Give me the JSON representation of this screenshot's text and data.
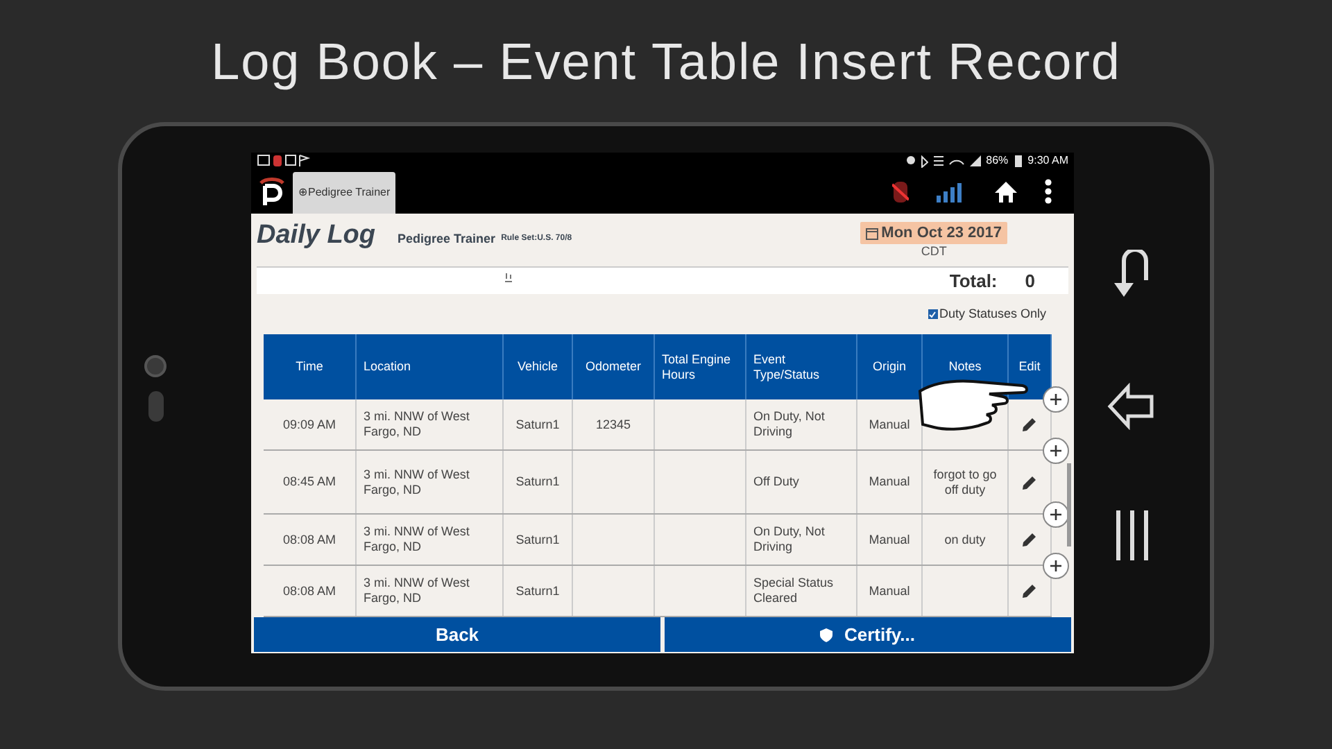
{
  "slide_title": "Log Book – Event Table Insert Record",
  "status_bar": {
    "battery": "86%",
    "time": "9:30 AM"
  },
  "tabs": [
    {
      "label": "⊕Pedigree Trainer",
      "selected": true
    }
  ],
  "header": {
    "title": "Daily Log",
    "driver": "Pedigree Trainer",
    "rule_set": "Rule Set:U.S. 70/8",
    "date": "Mon Oct 23 2017",
    "timezone": "CDT"
  },
  "total": {
    "label": "Total:",
    "value": "0"
  },
  "filter": {
    "label": "Duty Statuses Only",
    "checked": true
  },
  "table": {
    "columns": [
      "Time",
      "Location",
      "Vehicle",
      "Odometer",
      "Total Engine Hours",
      "Event Type/Status",
      "Origin",
      "Notes",
      "Edit"
    ],
    "rows": [
      {
        "time": "09:09 AM",
        "location": "3 mi. NNW of West Fargo, ND",
        "vehicle": "Saturn1",
        "odometer": "12345",
        "engine_hours": "",
        "event": "On Duty, Not Driving",
        "origin": "Manual",
        "notes": ""
      },
      {
        "time": "08:45 AM",
        "location": "3 mi. NNW of West Fargo, ND",
        "vehicle": "Saturn1",
        "odometer": "",
        "engine_hours": "",
        "event": "Off Duty",
        "origin": "Manual",
        "notes": "forgot to go off duty"
      },
      {
        "time": "08:08 AM",
        "location": "3 mi. NNW of West Fargo, ND",
        "vehicle": "Saturn1",
        "odometer": "",
        "engine_hours": "",
        "event": "On Duty, Not Driving",
        "origin": "Manual",
        "notes": "on duty"
      },
      {
        "time": "08:08 AM",
        "location": "3 mi. NNW of West Fargo, ND",
        "vehicle": "Saturn1",
        "odometer": "",
        "engine_hours": "",
        "event": "Special Status Cleared",
        "origin": "Manual",
        "notes": ""
      }
    ]
  },
  "buttons": [
    {
      "label": "Back",
      "kind": "plain"
    },
    {
      "label": "Certify...",
      "kind": "certify"
    }
  ]
}
